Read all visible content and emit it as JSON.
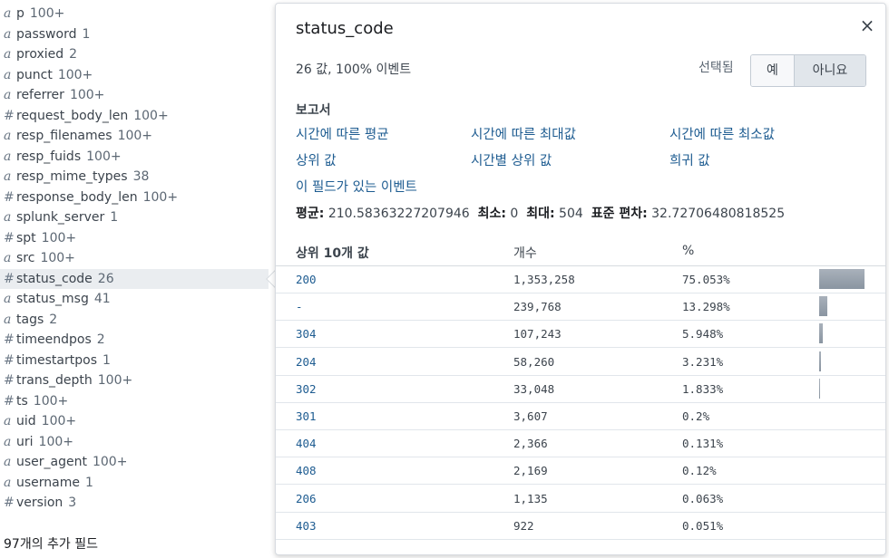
{
  "field_list": {
    "partial_top": "a",
    "fields": [
      {
        "type": "a",
        "name": "p",
        "count": "100+"
      },
      {
        "type": "a",
        "name": "password",
        "count": "1"
      },
      {
        "type": "a",
        "name": "proxied",
        "count": "2"
      },
      {
        "type": "a",
        "name": "punct",
        "count": "100+"
      },
      {
        "type": "a",
        "name": "referrer",
        "count": "100+"
      },
      {
        "type": "#",
        "name": "request_body_len",
        "count": "100+"
      },
      {
        "type": "a",
        "name": "resp_filenames",
        "count": "100+"
      },
      {
        "type": "a",
        "name": "resp_fuids",
        "count": "100+"
      },
      {
        "type": "a",
        "name": "resp_mime_types",
        "count": "38"
      },
      {
        "type": "#",
        "name": "response_body_len",
        "count": "100+"
      },
      {
        "type": "a",
        "name": "splunk_server",
        "count": "1"
      },
      {
        "type": "#",
        "name": "spt",
        "count": "100+"
      },
      {
        "type": "a",
        "name": "src",
        "count": "100+"
      },
      {
        "type": "#",
        "name": "status_code",
        "count": "26",
        "active": true
      },
      {
        "type": "a",
        "name": "status_msg",
        "count": "41"
      },
      {
        "type": "a",
        "name": "tags",
        "count": "2"
      },
      {
        "type": "#",
        "name": "timeendpos",
        "count": "2"
      },
      {
        "type": "#",
        "name": "timestartpos",
        "count": "1"
      },
      {
        "type": "#",
        "name": "trans_depth",
        "count": "100+"
      },
      {
        "type": "#",
        "name": "ts",
        "count": "100+"
      },
      {
        "type": "a",
        "name": "uid",
        "count": "100+"
      },
      {
        "type": "a",
        "name": "uri",
        "count": "100+"
      },
      {
        "type": "a",
        "name": "user_agent",
        "count": "100+"
      },
      {
        "type": "a",
        "name": "username",
        "count": "1"
      },
      {
        "type": "#",
        "name": "version",
        "count": "3"
      }
    ],
    "more_fields": "97개의 추가 필드"
  },
  "popover": {
    "title": "status_code",
    "close": "×",
    "summary": "26 값, 100% 이벤트",
    "selected_label": "선택됨",
    "yes_label": "예",
    "no_label": "아니요",
    "reports_heading": "보고서",
    "reports": [
      "시간에 따른 평균",
      "시간에 따른 최대값",
      "시간에 따른 최소값",
      "상위 값",
      "시간별 상위 값",
      "희귀 값",
      "이 필드가 있는 이벤트"
    ],
    "stats": {
      "avg_label": "평균:",
      "avg": "210.58363227207946",
      "min_label": "최소:",
      "min": "0",
      "max_label": "최대:",
      "max": "504",
      "std_label": "표준 편차:",
      "std": "32.72706480818525"
    },
    "table": {
      "headers": [
        "상위 10개 값",
        "개수",
        "%"
      ],
      "rows": [
        {
          "value": "200",
          "count": "1,353,258",
          "percent": "75.053%",
          "share": 75.053
        },
        {
          "value": "-",
          "count": "239,768",
          "percent": "13.298%",
          "share": 13.298
        },
        {
          "value": "304",
          "count": "107,243",
          "percent": "5.948%",
          "share": 5.948
        },
        {
          "value": "204",
          "count": "58,260",
          "percent": "3.231%",
          "share": 3.231
        },
        {
          "value": "302",
          "count": "33,048",
          "percent": "1.833%",
          "share": 1.833
        },
        {
          "value": "301",
          "count": "3,607",
          "percent": "0.2%",
          "share": 0.2
        },
        {
          "value": "404",
          "count": "2,366",
          "percent": "0.131%",
          "share": 0.131
        },
        {
          "value": "408",
          "count": "2,169",
          "percent": "0.12%",
          "share": 0.12
        },
        {
          "value": "206",
          "count": "1,135",
          "percent": "0.063%",
          "share": 0.063
        },
        {
          "value": "403",
          "count": "922",
          "percent": "0.051%",
          "share": 0.051
        }
      ]
    }
  }
}
